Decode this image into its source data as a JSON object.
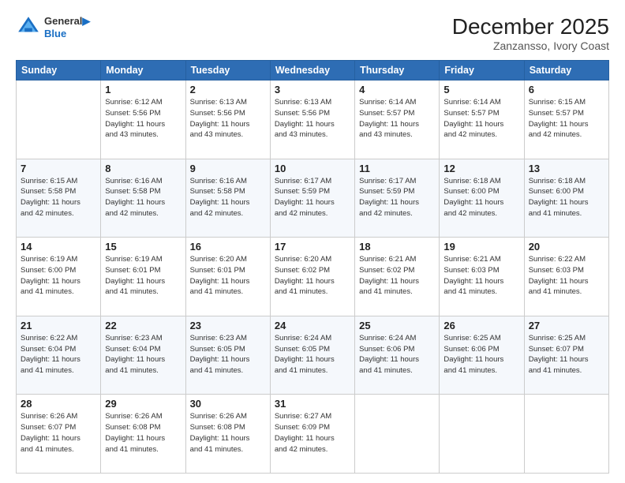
{
  "header": {
    "logo_line1": "General",
    "logo_line2": "Blue",
    "title": "December 2025",
    "subtitle": "Zanzansso, Ivory Coast"
  },
  "calendar": {
    "days_of_week": [
      "Sunday",
      "Monday",
      "Tuesday",
      "Wednesday",
      "Thursday",
      "Friday",
      "Saturday"
    ],
    "weeks": [
      [
        {
          "day": "",
          "info": ""
        },
        {
          "day": "1",
          "info": "Sunrise: 6:12 AM\nSunset: 5:56 PM\nDaylight: 11 hours\nand 43 minutes."
        },
        {
          "day": "2",
          "info": "Sunrise: 6:13 AM\nSunset: 5:56 PM\nDaylight: 11 hours\nand 43 minutes."
        },
        {
          "day": "3",
          "info": "Sunrise: 6:13 AM\nSunset: 5:56 PM\nDaylight: 11 hours\nand 43 minutes."
        },
        {
          "day": "4",
          "info": "Sunrise: 6:14 AM\nSunset: 5:57 PM\nDaylight: 11 hours\nand 43 minutes."
        },
        {
          "day": "5",
          "info": "Sunrise: 6:14 AM\nSunset: 5:57 PM\nDaylight: 11 hours\nand 42 minutes."
        },
        {
          "day": "6",
          "info": "Sunrise: 6:15 AM\nSunset: 5:57 PM\nDaylight: 11 hours\nand 42 minutes."
        }
      ],
      [
        {
          "day": "7",
          "info": "Sunrise: 6:15 AM\nSunset: 5:58 PM\nDaylight: 11 hours\nand 42 minutes."
        },
        {
          "day": "8",
          "info": "Sunrise: 6:16 AM\nSunset: 5:58 PM\nDaylight: 11 hours\nand 42 minutes."
        },
        {
          "day": "9",
          "info": "Sunrise: 6:16 AM\nSunset: 5:58 PM\nDaylight: 11 hours\nand 42 minutes."
        },
        {
          "day": "10",
          "info": "Sunrise: 6:17 AM\nSunset: 5:59 PM\nDaylight: 11 hours\nand 42 minutes."
        },
        {
          "day": "11",
          "info": "Sunrise: 6:17 AM\nSunset: 5:59 PM\nDaylight: 11 hours\nand 42 minutes."
        },
        {
          "day": "12",
          "info": "Sunrise: 6:18 AM\nSunset: 6:00 PM\nDaylight: 11 hours\nand 42 minutes."
        },
        {
          "day": "13",
          "info": "Sunrise: 6:18 AM\nSunset: 6:00 PM\nDaylight: 11 hours\nand 41 minutes."
        }
      ],
      [
        {
          "day": "14",
          "info": "Sunrise: 6:19 AM\nSunset: 6:00 PM\nDaylight: 11 hours\nand 41 minutes."
        },
        {
          "day": "15",
          "info": "Sunrise: 6:19 AM\nSunset: 6:01 PM\nDaylight: 11 hours\nand 41 minutes."
        },
        {
          "day": "16",
          "info": "Sunrise: 6:20 AM\nSunset: 6:01 PM\nDaylight: 11 hours\nand 41 minutes."
        },
        {
          "day": "17",
          "info": "Sunrise: 6:20 AM\nSunset: 6:02 PM\nDaylight: 11 hours\nand 41 minutes."
        },
        {
          "day": "18",
          "info": "Sunrise: 6:21 AM\nSunset: 6:02 PM\nDaylight: 11 hours\nand 41 minutes."
        },
        {
          "day": "19",
          "info": "Sunrise: 6:21 AM\nSunset: 6:03 PM\nDaylight: 11 hours\nand 41 minutes."
        },
        {
          "day": "20",
          "info": "Sunrise: 6:22 AM\nSunset: 6:03 PM\nDaylight: 11 hours\nand 41 minutes."
        }
      ],
      [
        {
          "day": "21",
          "info": "Sunrise: 6:22 AM\nSunset: 6:04 PM\nDaylight: 11 hours\nand 41 minutes."
        },
        {
          "day": "22",
          "info": "Sunrise: 6:23 AM\nSunset: 6:04 PM\nDaylight: 11 hours\nand 41 minutes."
        },
        {
          "day": "23",
          "info": "Sunrise: 6:23 AM\nSunset: 6:05 PM\nDaylight: 11 hours\nand 41 minutes."
        },
        {
          "day": "24",
          "info": "Sunrise: 6:24 AM\nSunset: 6:05 PM\nDaylight: 11 hours\nand 41 minutes."
        },
        {
          "day": "25",
          "info": "Sunrise: 6:24 AM\nSunset: 6:06 PM\nDaylight: 11 hours\nand 41 minutes."
        },
        {
          "day": "26",
          "info": "Sunrise: 6:25 AM\nSunset: 6:06 PM\nDaylight: 11 hours\nand 41 minutes."
        },
        {
          "day": "27",
          "info": "Sunrise: 6:25 AM\nSunset: 6:07 PM\nDaylight: 11 hours\nand 41 minutes."
        }
      ],
      [
        {
          "day": "28",
          "info": "Sunrise: 6:26 AM\nSunset: 6:07 PM\nDaylight: 11 hours\nand 41 minutes."
        },
        {
          "day": "29",
          "info": "Sunrise: 6:26 AM\nSunset: 6:08 PM\nDaylight: 11 hours\nand 41 minutes."
        },
        {
          "day": "30",
          "info": "Sunrise: 6:26 AM\nSunset: 6:08 PM\nDaylight: 11 hours\nand 41 minutes."
        },
        {
          "day": "31",
          "info": "Sunrise: 6:27 AM\nSunset: 6:09 PM\nDaylight: 11 hours\nand 42 minutes."
        },
        {
          "day": "",
          "info": ""
        },
        {
          "day": "",
          "info": ""
        },
        {
          "day": "",
          "info": ""
        }
      ]
    ]
  }
}
